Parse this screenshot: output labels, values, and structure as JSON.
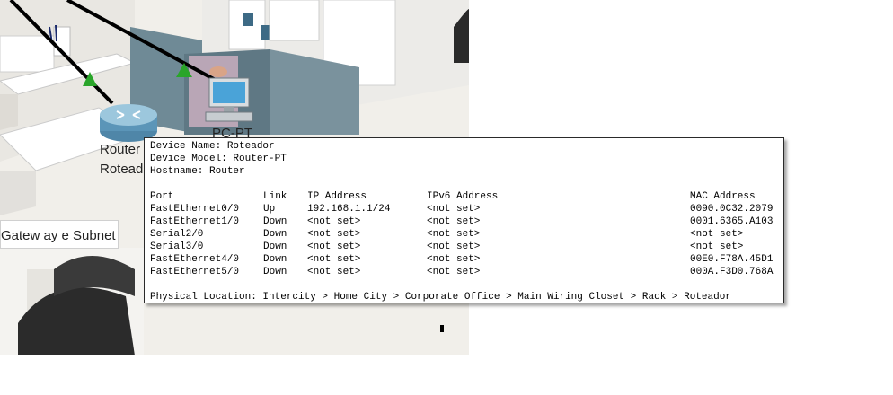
{
  "workspace": {
    "router_label_line1": "Router",
    "router_label_line2": "Roteado",
    "pc_label": "PC-PT",
    "note_text": "Gatew ay e Subnet"
  },
  "tooltip": {
    "device_name": "Device Name: Roteador",
    "device_model": "Device Model: Router-PT",
    "hostname": "Hostname: Router",
    "columns": [
      "Port",
      "Link",
      "IP Address",
      "IPv6 Address",
      "MAC Address"
    ],
    "rows": [
      {
        "port": "FastEthernet0/0",
        "link": "Up",
        "ip": "192.168.1.1/24",
        "ipv6": "<not set>",
        "mac": "0090.0C32.2079"
      },
      {
        "port": "FastEthernet1/0",
        "link": "Down",
        "ip": "<not set>",
        "ipv6": "<not set>",
        "mac": "0001.6365.A103"
      },
      {
        "port": "Serial2/0",
        "link": "Down",
        "ip": "<not set>",
        "ipv6": "<not set>",
        "mac": "<not set>"
      },
      {
        "port": "Serial3/0",
        "link": "Down",
        "ip": "<not set>",
        "ipv6": "<not set>",
        "mac": "<not set>"
      },
      {
        "port": "FastEthernet4/0",
        "link": "Down",
        "ip": "<not set>",
        "ipv6": "<not set>",
        "mac": "00E0.F78A.45D1"
      },
      {
        "port": "FastEthernet5/0",
        "link": "Down",
        "ip": "<not set>",
        "ipv6": "<not set>",
        "mac": "000A.F3D0.768A"
      }
    ],
    "physical_location": "Physical Location: Intercity > Home City > Corporate Office > Main Wiring Closet > Rack > Roteador"
  },
  "icons": {
    "router": "router-icon",
    "pc": "pc-icon",
    "link_status": "link-up-triangle-icon"
  },
  "colors": {
    "partition": "#6f8a96",
    "desk": "#ffffff",
    "link_up": "#2aa52a",
    "cable": "#000000"
  }
}
